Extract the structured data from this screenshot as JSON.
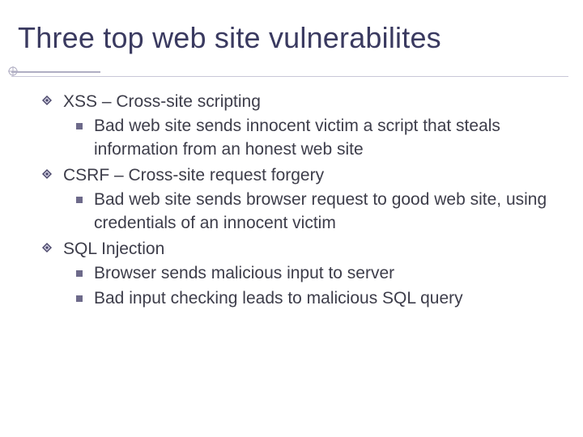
{
  "title": "Three top web site vulnerabilites",
  "items": [
    {
      "label": "XSS – Cross-site scripting",
      "sub": [
        "Bad web site sends innocent victim a script that steals information from an honest web site"
      ]
    },
    {
      "label": "CSRF – Cross-site request forgery",
      "sub": [
        "Bad web site sends browser request to good web site, using credentials of an innocent victim"
      ]
    },
    {
      "label": "SQL Injection",
      "sub": [
        "Browser sends malicious input to server",
        "Bad input checking leads to malicious SQL query"
      ]
    }
  ]
}
